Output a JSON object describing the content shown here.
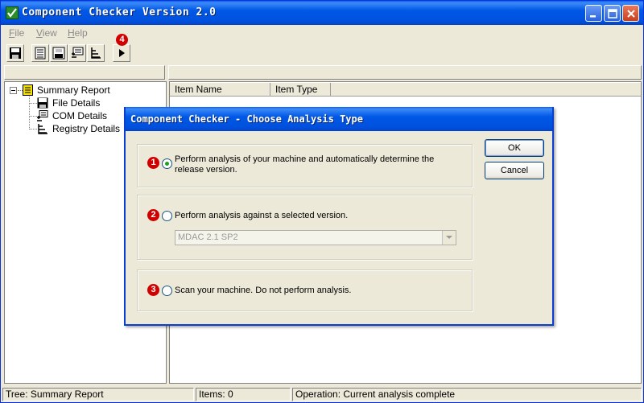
{
  "window": {
    "title": "Component Checker Version 2.0"
  },
  "menu": {
    "file": "File",
    "file_key": "F",
    "view": "View",
    "view_key": "V",
    "help": "Help",
    "help_key": "H"
  },
  "toolbar": {
    "badge_run": "4"
  },
  "list": {
    "col_item_name": "Item Name",
    "col_item_type": "Item Type"
  },
  "tree": {
    "root": "Summary Report",
    "children": [
      "File Details",
      "COM Details",
      "Registry Details"
    ]
  },
  "status": {
    "tree": "Tree: Summary Report",
    "items": "Items: 0",
    "operation": "Operation: Current analysis complete"
  },
  "dialog": {
    "title": "Component Checker - Choose Analysis Type",
    "options": [
      {
        "badge": "1",
        "label_line1": "Perform analysis of your machine and automatically determine the",
        "label_line2": "release version.",
        "checked": true
      },
      {
        "badge": "2",
        "label_line1": "Perform analysis against a selected version.",
        "checked": false
      },
      {
        "badge": "3",
        "label_line1": "Scan your machine.  Do not perform analysis.",
        "checked": false
      }
    ],
    "version_select": "MDAC 2.1 SP2",
    "ok": "OK",
    "cancel": "Cancel"
  },
  "colors": {
    "title_blue": "#0058e6",
    "badge_red": "#d10000",
    "face": "#ece9d8"
  }
}
